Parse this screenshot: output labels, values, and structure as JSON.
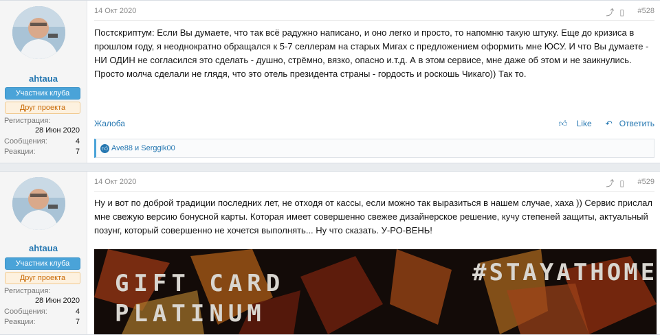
{
  "posts": [
    {
      "user": {
        "name": "ahtaua",
        "badge1": "Участник клуба",
        "badge2": "Друг проекта",
        "reg_label": "Регистрация:",
        "reg_value": "28 Июн 2020",
        "msg_label": "Сообщения:",
        "msg_value": "4",
        "react_label": "Реакции:",
        "react_value": "7"
      },
      "date": "14 Окт 2020",
      "number": "#528",
      "text": "Постскриптум: Если Вы думаете, что так всё радужно написано, и оно легко и просто, то напомню такую штуку. Еще до кризиса в прошлом году, я неоднократно обращался к 5-7 селлерам на старых Мигах с предложением оформить мне ЮСУ. И что Вы думаете - НИ ОДИН не согласился это сделать - душно, стрёмно, вязко, опасно и.т.д. А в этом сервисе, мне даже об этом и не заикнулись. Просто молча сделали не глядя, что это отель президента страны - гордость и роскошь Чикаго)) Так то.",
      "report": "Жалоба",
      "like": "Like",
      "reply": "Ответить",
      "likes_text": "Ave88 и Serggik00"
    },
    {
      "user": {
        "name": "ahtaua",
        "badge1": "Участник клуба",
        "badge2": "Друг проекта",
        "reg_label": "Регистрация:",
        "reg_value": "28 Июн 2020",
        "msg_label": "Сообщения:",
        "msg_value": "4",
        "react_label": "Реакции:",
        "react_value": "7"
      },
      "date": "14 Окт 2020",
      "number": "#529",
      "text": "Ну и вот по доброй традиции последних лет, не отходя от кассы, если можно так выразиться в нашем случае, хаха )) Сервис прислал мне свежую версию бонусной карты. Которая имеет совершенно свежее дизайнерское решение, кучу степеней защиты, актуальный позунг, который совершенно не хочется выполнять... Ну что сказать. У-РО-ВЕНЬ!",
      "banner": {
        "line1": "GIFT CARD",
        "line2": "PLATINUM",
        "tag": "#STAYATHOME"
      }
    }
  ],
  "icons": {
    "share": "share-icon",
    "bookmark": "bookmark-icon",
    "like": "thumbs-up-icon",
    "reply": "reply-icon"
  },
  "colors": {
    "link": "#2577b1",
    "badge_blue": "#4aa3d8",
    "badge_orange": "#c96a06"
  }
}
